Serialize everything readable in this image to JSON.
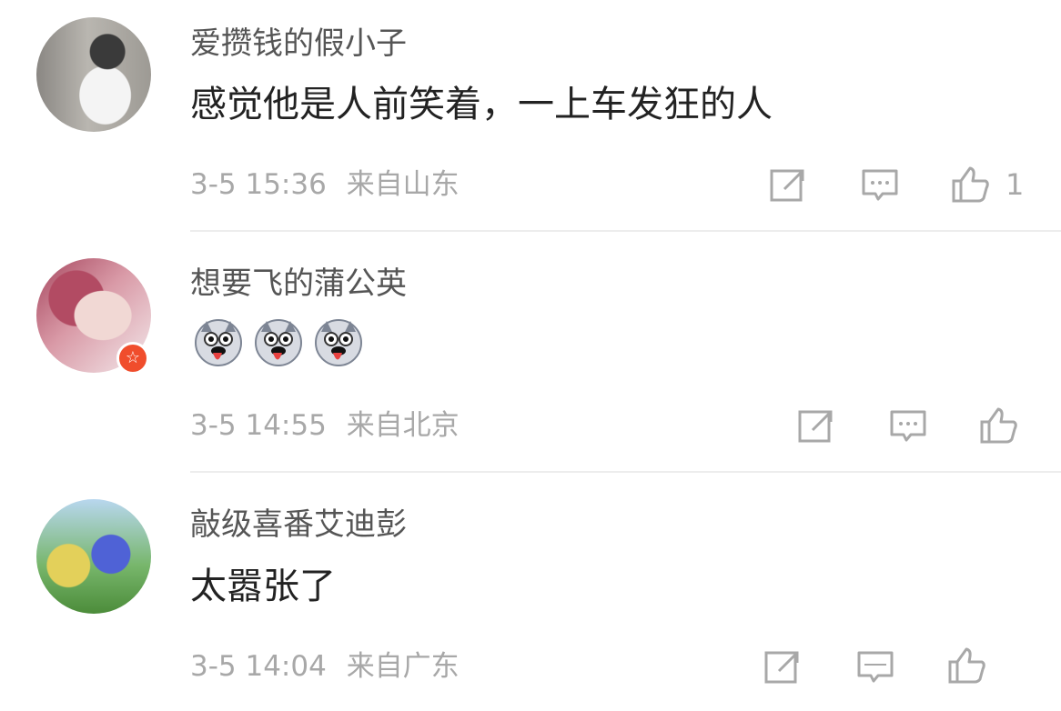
{
  "comments": [
    {
      "username": "爱攒钱的假小子",
      "text": "感觉他是人前笑着，一上车发狂的人",
      "timestamp": "3-5 15:36",
      "location": "来自山东",
      "like_count": "1",
      "icons": {
        "share": "share-icon",
        "comment": "comment-icon",
        "like": "thumbs-up-icon"
      }
    },
    {
      "username": "想要飞的蒲公英",
      "emojis": [
        "husky-emoji",
        "husky-emoji",
        "husky-emoji"
      ],
      "timestamp": "3-5 14:55",
      "location": "来自北京",
      "badge": "☆",
      "icons": {
        "share": "share-icon",
        "comment": "comment-icon",
        "like": "thumbs-up-icon"
      }
    },
    {
      "username": "敲级喜番艾迪彭",
      "text": "太嚣张了",
      "timestamp": "3-5 14:04",
      "location": "来自广东",
      "icons": {
        "share": "share-icon",
        "comment": "comment-icon",
        "like": "thumbs-up-icon"
      }
    }
  ],
  "colors": {
    "username": "#555555",
    "body_text": "#222222",
    "meta": "#a8a8a8",
    "divider": "#ededed",
    "badge": "#f04d2c"
  }
}
